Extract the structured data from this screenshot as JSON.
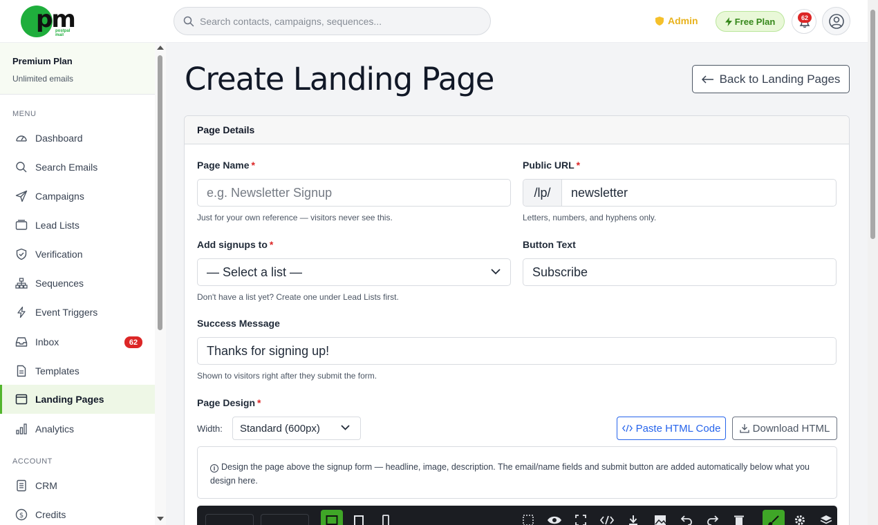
{
  "app": {
    "logo_text": "pm",
    "logo_sub": "postpal mail",
    "search_placeholder": "Search contacts, campaigns, sequences...",
    "admin_label": "Admin",
    "plan_badge": "Free Plan",
    "notification_count": "62",
    "colors": {
      "accent": "#52b52c",
      "brand": "#1fae3c",
      "danger": "#dc2626",
      "link": "#2563eb",
      "admin": "#e8b21c"
    }
  },
  "sidebar": {
    "plan_title": "Premium Plan",
    "plan_sub": "Unlimited emails",
    "menu_label": "MENU",
    "account_label": "ACCOUNT",
    "menu_items": [
      {
        "label": "Dashboard",
        "icon": "dashboard-icon"
      },
      {
        "label": "Search Emails",
        "icon": "search-icon"
      },
      {
        "label": "Campaigns",
        "icon": "send-icon"
      },
      {
        "label": "Lead Lists",
        "icon": "folder-icon"
      },
      {
        "label": "Verification",
        "icon": "shield-icon"
      },
      {
        "label": "Sequences",
        "icon": "diagram-icon"
      },
      {
        "label": "Event Triggers",
        "icon": "lightning-icon"
      },
      {
        "label": "Inbox",
        "icon": "inbox-icon",
        "badge": "62"
      },
      {
        "label": "Templates",
        "icon": "document-icon"
      },
      {
        "label": "Landing Pages",
        "icon": "window-icon",
        "active": true
      },
      {
        "label": "Analytics",
        "icon": "bar-chart-icon"
      }
    ],
    "account_items": [
      {
        "label": "CRM",
        "icon": "notebook-icon"
      },
      {
        "label": "Credits",
        "icon": "coin-icon"
      }
    ]
  },
  "main": {
    "title": "Create Landing Page",
    "back_button": "Back to Landing Pages",
    "card_title": "Page Details",
    "page_name": {
      "label": "Page Name",
      "required": "*",
      "placeholder": "e.g. Newsletter Signup",
      "value": "",
      "help": "Just for your own reference — visitors never see this."
    },
    "public_url": {
      "label": "Public URL",
      "required": "*",
      "prefix": "/lp/",
      "value": "newsletter",
      "help": "Letters, numbers, and hyphens only."
    },
    "add_signups": {
      "label": "Add signups to",
      "required": "*",
      "selected": "— Select a list —",
      "help": "Don't have a list yet? Create one under Lead Lists first."
    },
    "button_text": {
      "label": "Button Text",
      "value": "Subscribe"
    },
    "success_message": {
      "label": "Success Message",
      "value": "Thanks for signing up!",
      "help": "Shown to visitors right after they submit the form."
    },
    "page_design": {
      "label": "Page Design",
      "required": "*",
      "width_label": "Width:",
      "width_selected": "Standard (600px)",
      "paste_button": "Paste HTML Code",
      "download_button": "Download HTML",
      "info": "Design the page above the signup form — headline, image, description. The email/name fields and submit button are added automatically below what you design here."
    }
  }
}
